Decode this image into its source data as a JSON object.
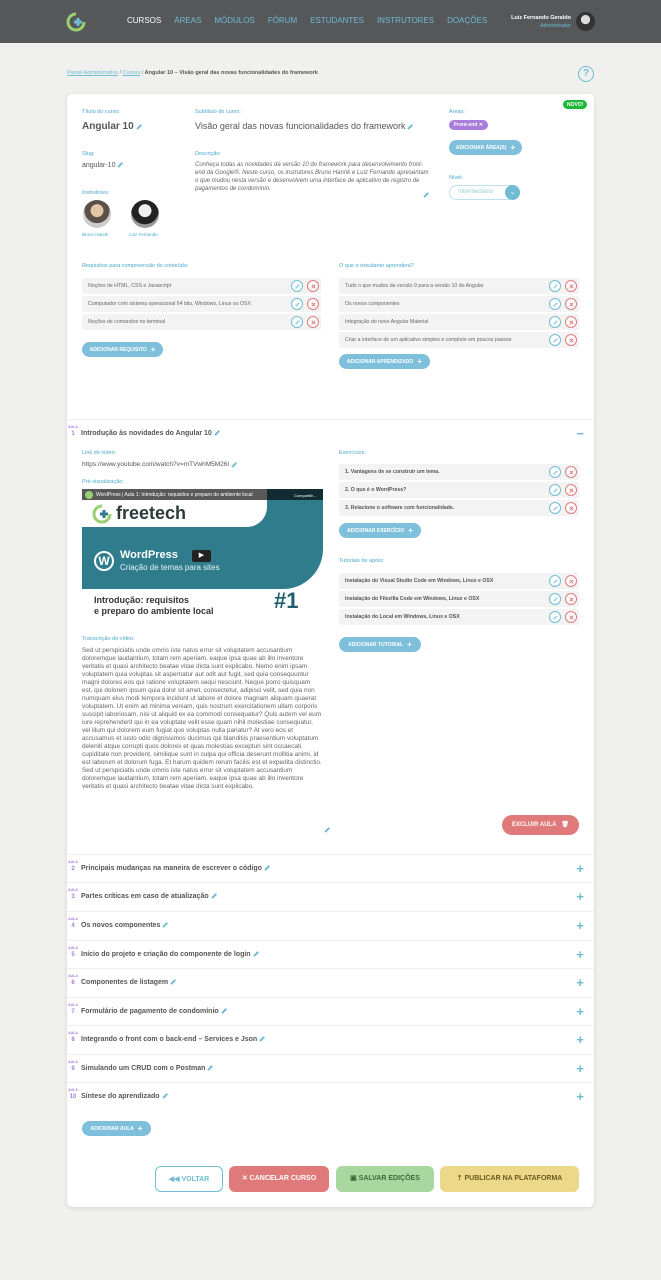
{
  "nav": {
    "items": [
      "CURSOS",
      "ÁREAS",
      "MÓDULOS",
      "FÓRUM",
      "ESTUDANTES",
      "INSTRUTORES",
      "DOAÇÕES"
    ]
  },
  "user": {
    "name": "Luiz Fernando Geraldo",
    "role": "Administrador"
  },
  "breadcrumb": {
    "part1": "Painel Administrativo",
    "part2": "Cursos",
    "current": "Angular 10 – Visão geral das novas funcionalidades do framework"
  },
  "course": {
    "badge": "NOVO!",
    "title_label": "Título do curso:",
    "title": "Angular 10",
    "subtitle_label": "Subtítulo do curso:",
    "subtitle": "Visão geral das novas funcionalidades do framework",
    "areas_label": "Áreas:",
    "area_tag": "Front-end",
    "add_area": "ADICIONAR ÁREA(S)",
    "slug_label": "Slug:",
    "slug": "angular-10",
    "description_label": "Descrição:",
    "description": "Conheça todas as novidades da versão 10 do framework para desenvolvimento front-end da Google®. Neste curso, os instrutores Bruno Hanrik e Luiz Fernando apresentam o que mudou nesta versão e desenvolvem uma interface de aplicativo de registro de pagamentos de condomínio.",
    "level_label": "Nível:",
    "level": "Intermediário",
    "instructors_label": "Instrutores:",
    "instructors": [
      "Bruno Hanrik",
      "Luiz Fernando"
    ],
    "requirements_label": "Requisitos para compreensão do conteúdo:",
    "requirements": [
      "Noções de HTML, CSS e Javascript",
      "Computador com sistema operacional 64 bits, Windows, Linux ou OSX",
      "Noções de comandos no terminal"
    ],
    "add_requirement": "ADICIONAR REQUISITO",
    "learn_label": "O que o estudante aprenderá?",
    "learn": [
      "Tudo o que mudou da versão 9 para a versão 10 do Angular",
      "Os novos componentes",
      "Integração do novo Angular Material",
      "Criar a interface de um aplicativo simples e completo em poucos passos"
    ],
    "add_learn": "ADICIONAR APRENDIZADO"
  },
  "lesson1": {
    "aula": "AULA",
    "num": "1",
    "title": "Introdução às novidades do Angular 10",
    "video_label": "Link do vídeo:",
    "video_link": "https://www.youtube.com/watch?v=mTVwhM5M26I",
    "preview_label": "Pré-visualização:",
    "video_title": "WordPress | Aula 1: Introdução: requisitos e preparo do ambiente local",
    "thumb_brand": "freetech",
    "thumb_product": "WordPress",
    "thumb_subtitle": "Criação de temas para sites",
    "thumb_line1": "Introdução: requisitos",
    "thumb_line2": "e preparo do ambiente local",
    "thumb_num": "#1",
    "thumb_share": "Compartilh...",
    "transcript_label": "Transcrição do vídeo:",
    "transcript": "Sed ut perspiciatis unde omnis iste natus error sit voluptatem accusantium doloremque laudantium, totam rem aperiam, eaque ipsa quae ab illo inventore veritatis et quasi architecto beatae vitae dicta sunt explicabo. Nemo enim ipsam voluptatem quia voluptas sit aspernatur aut odit aut fugit, sed quia consequuntur magni dolores eos qui ratione voluptatem sequi nesciunt. Neque porro quisquam est, qui dolorem ipsum quia dolor sit amet, consectetur, adipisci velit, sed quia non numquam eius modi tempora incidunt ut labore et dolore magnam aliquam quaerat voluptatem. Ut enim ad minima veniam, quis nostrum exercitationem ullam corporis suscipit laboriosam, nisi ut aliquid ex ea commodi consequatur? Quis autem vel eum iure reprehenderit qui in ea voluptate velit esse quam nihil molestiae consequatur, vel illum qui dolorem eum fugiat quo voluptas nulla pariatur? At vero eos et accusamus et iusto odio dignissimos ducimus qui blanditiis praesentium voluptatum deleniti atque corrupti quos dolores et quas molestias excepturi sint occaecati cupiditate non provident, similique sunt in culpa qui officia deserunt mollitia animi, id est laborum et dolorum fuga. Et harum quidem rerum facilis est et expedita distinctio. Sed ut perspiciatis unde omnis iste natus error sit voluptatem accusantium doloremque laudantium, totam rem aperiam, eaque ipsa quae ab illo inventore veritatis et quasi architecto beatae vitae dicta sunt explicabo.",
    "exercises_label": "Exercícios:",
    "exercises": [
      "1. Vantagens de se construir um tema.",
      "2. O que é o WordPress?",
      "3. Relacione o software com funcionalidade."
    ],
    "add_exercise": "ADICIONAR EXERCÍCIO",
    "tutorials_label": "Tutoriais de apoio:",
    "tutorials": [
      "Instalação do Visual Studio Code em Windows, Linux e OSX",
      "Instalação do Filezilla Code em Windows, Linux e OSX",
      "Instalação do Local em Windows, Linux e OSX"
    ],
    "add_tutorial": "ADICIONAR TUTORIAL",
    "delete": "EXCLUIR AULA"
  },
  "lessons": [
    {
      "aula": "AULA",
      "num": "2",
      "title": "Principais mudanças na maneira de escrever o código"
    },
    {
      "aula": "AULA",
      "num": "3",
      "title": "Partes críticas em caso de atualização"
    },
    {
      "aula": "AULA",
      "num": "4",
      "title": "Os novos componentes"
    },
    {
      "aula": "AULA",
      "num": "5",
      "title": "Início do projeto e criação do componente de login"
    },
    {
      "aula": "AULA",
      "num": "6",
      "title": "Componentes de listagem"
    },
    {
      "aula": "AULA",
      "num": "7",
      "title": "Formulário de pagamento de condomínio"
    },
    {
      "aula": "AULA",
      "num": "8",
      "title": "Integrando o front com o back-end – Services e Json"
    },
    {
      "aula": "AULA",
      "num": "9",
      "title": "Simulando um CRUD com o Postman"
    },
    {
      "aula": "AULA",
      "num": "10",
      "title": "Síntese do aprendizado"
    }
  ],
  "add_lesson": "ADICIONAR AULA",
  "actions": {
    "back": "VOLTAR",
    "cancel": "CANCELAR CURSO",
    "save": "SALVAR EDIÇÕES",
    "publish": "PUBLICAR NA PLATAFORMA"
  },
  "colors": {
    "accent": "#6fbcd4",
    "purple": "#a87cdb",
    "new": "#1db838",
    "danger": "#e07a7a",
    "save": "#a8d8a0",
    "publish": "#ecd888"
  }
}
